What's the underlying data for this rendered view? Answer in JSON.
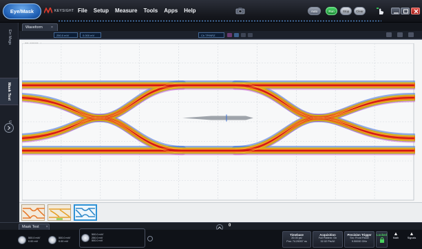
{
  "titlebar": {
    "mode_label": "Eye/Mask",
    "brand": "KEYSIGHT",
    "menu": [
      "File",
      "Setup",
      "Measure",
      "Tools",
      "Apps",
      "Help"
    ],
    "buttons": {
      "auto": "Auto",
      "run": "Run",
      "stop": "Stop",
      "clear": "Clear"
    }
  },
  "left_panel": {
    "tabs": [
      "Err Msgs",
      "Mask Test",
      "User"
    ]
  },
  "waveform": {
    "tab_label": "Waveform",
    "tab_close": "×",
    "info": {
      "field1": "250.0 mV/",
      "field2": "0.000 mV",
      "field3": "Ch TP/NRZ",
      "plot_tag": "TE 20037 ✓"
    },
    "right_marker": "◄1"
  },
  "eye": {
    "colors": {
      "outer": "#c8b414",
      "mid": "#ee6a1b",
      "core": "#d1141a",
      "edge_blue": "#3a6bd8",
      "edge_magenta": "#c845c4"
    }
  },
  "thumbnails": [
    "thumb-1",
    "thumb-2",
    "thumb-3"
  ],
  "bottom": {
    "tab_label": "Mask Test",
    "tab_close": "×",
    "indicator": "0",
    "channels": [
      {
        "l1": "500.0 mV/",
        "l2": "0.00 mV"
      },
      {
        "l1": "500.0 mV/",
        "l2": "0.00 mV"
      },
      {
        "l1": "500.0 mV/",
        "l2": "250.0 mV",
        "l3": "500.0 mV"
      }
    ],
    "status": {
      "timebase": {
        "title": "Timebase",
        "l1": "20.00 ps/",
        "l2": "Pos: 74.29057 ns"
      },
      "acquisition": {
        "title": "Acquisition",
        "l1": "Full Pattern: On",
        "l2": "32.02 Pts/UI"
      },
      "trigger": {
        "title": "Precision Trigger",
        "l1": "Src: Front Panel",
        "l2": "9.90000 GHz"
      },
      "lock": {
        "title": "Locked"
      }
    },
    "math_label": "Math",
    "signals_label": "Signals"
  }
}
